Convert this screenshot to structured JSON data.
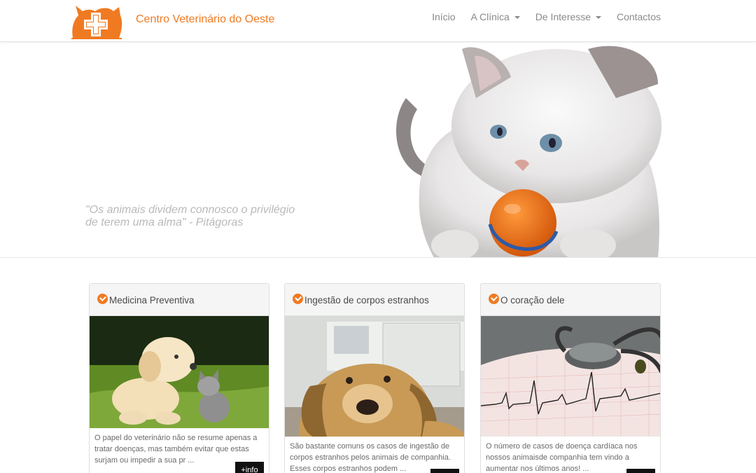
{
  "header": {
    "brand_name": "Centro Veterinário do Oeste",
    "nav": [
      {
        "label": "Início",
        "dropdown": false
      },
      {
        "label": "A Clínica",
        "dropdown": true
      },
      {
        "label": "De Interesse",
        "dropdown": true
      },
      {
        "label": "Contactos",
        "dropdown": false
      }
    ]
  },
  "hero": {
    "quote_line1": "\"Os animais dividem connosco o privilégio",
    "quote_line2": "de terem uma alma\" - Pitágoras"
  },
  "cards": [
    {
      "title": "Medicina Preventiva",
      "text": "O papel do veterinário não se resume apenas a tratar doenças, mas também evitar que estas surjam ou impedir a sua pr ...",
      "button": "+info",
      "image": "puppy-and-kitten"
    },
    {
      "title": "Ingestão de corpos estranhos",
      "text": "São bastante comuns os casos de ingestão de corpos estranhos pelos animais de companhia. Esses corpos estranhos podem ...",
      "button": "",
      "image": "dog-lying-down"
    },
    {
      "title": "O coração dele",
      "text": "O número de casos de doença cardíaca nos nossos animaisde companhia tem vindo a aumentar nos últimos anos! ...",
      "button": "",
      "image": "stethoscope-ecg"
    }
  ],
  "colors": {
    "accent": "#f07a22",
    "nav_text": "#8a8a8a",
    "quote": "#b9b9b9",
    "button_bg": "#111111"
  },
  "icons": {
    "logo": "pets-with-cross-logo",
    "card_header": "check-circle-icon",
    "dropdown": "caret-down-icon"
  }
}
